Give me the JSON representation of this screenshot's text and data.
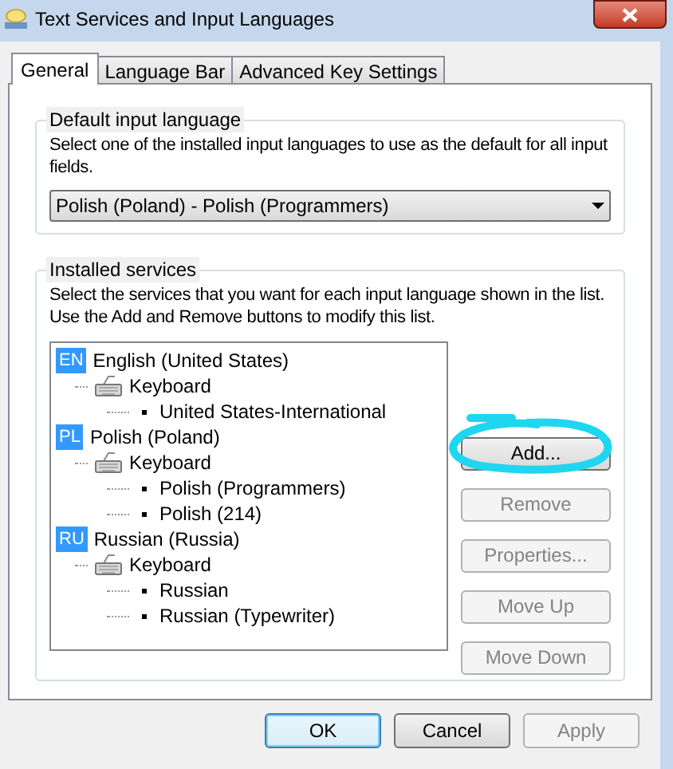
{
  "window": {
    "title": "Text Services and Input Languages"
  },
  "tabs": [
    {
      "label": "General",
      "selected": true
    },
    {
      "label": "Language Bar",
      "selected": false
    },
    {
      "label": "Advanced Key Settings",
      "selected": false
    }
  ],
  "default_language": {
    "title": "Default input language",
    "description": "Select one of the installed input languages to use as the default for all input fields.",
    "value": "Polish (Poland) - Polish (Programmers)"
  },
  "installed_services": {
    "title": "Installed services",
    "description": "Select the services that you want for each input language shown in the list. Use the Add and Remove buttons to modify this list.",
    "tree": [
      {
        "kind": "language",
        "badge": "EN",
        "label": "English (United States)",
        "children": [
          {
            "kind": "category",
            "label": "Keyboard",
            "children": [
              {
                "kind": "layout",
                "label": "United States-International"
              }
            ]
          }
        ]
      },
      {
        "kind": "language",
        "badge": "PL",
        "label": "Polish (Poland)",
        "children": [
          {
            "kind": "category",
            "label": "Keyboard",
            "children": [
              {
                "kind": "layout",
                "label": "Polish (Programmers)"
              },
              {
                "kind": "layout",
                "label": "Polish (214)"
              }
            ]
          }
        ]
      },
      {
        "kind": "language",
        "badge": "RU",
        "label": "Russian (Russia)",
        "children": [
          {
            "kind": "category",
            "label": "Keyboard",
            "children": [
              {
                "kind": "layout",
                "label": "Russian"
              },
              {
                "kind": "layout",
                "label": "Russian (Typewriter)"
              }
            ]
          }
        ]
      }
    ],
    "buttons": [
      {
        "label": "Add...",
        "disabled": false,
        "highlighted": true
      },
      {
        "label": "Remove",
        "disabled": true,
        "highlighted": false
      },
      {
        "label": "Properties...",
        "disabled": true,
        "highlighted": false
      },
      {
        "label": "Move Up",
        "disabled": true,
        "highlighted": false
      },
      {
        "label": "Move Down",
        "disabled": true,
        "highlighted": false
      }
    ]
  },
  "footer_buttons": [
    {
      "label": "OK",
      "disabled": false,
      "default": true
    },
    {
      "label": "Cancel",
      "disabled": false,
      "default": false
    },
    {
      "label": "Apply",
      "disabled": true,
      "default": false
    }
  ]
}
